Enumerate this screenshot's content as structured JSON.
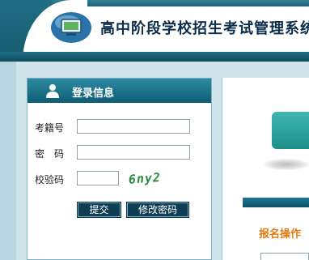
{
  "header": {
    "title": "高中阶段学校招生考试管理系统"
  },
  "login": {
    "title": "登录信息",
    "exam_id_label": "考籍号",
    "exam_id_value": "",
    "password_label": "密　码",
    "password_value": "",
    "captcha_label": "校验码",
    "captcha_value": "",
    "captcha_text": "6ny2",
    "submit_label": "提交",
    "change_password_label": "修改密码"
  },
  "right_panel": {
    "section_label": "报名操作"
  },
  "colors": {
    "header_band": "#1f6d84",
    "panel_head": "#0f5d74",
    "button_bg": "#0e3e54",
    "accent_orange": "#e07a12",
    "captcha_green": "#2c8a3e",
    "teal_button": "#2aa39d"
  }
}
